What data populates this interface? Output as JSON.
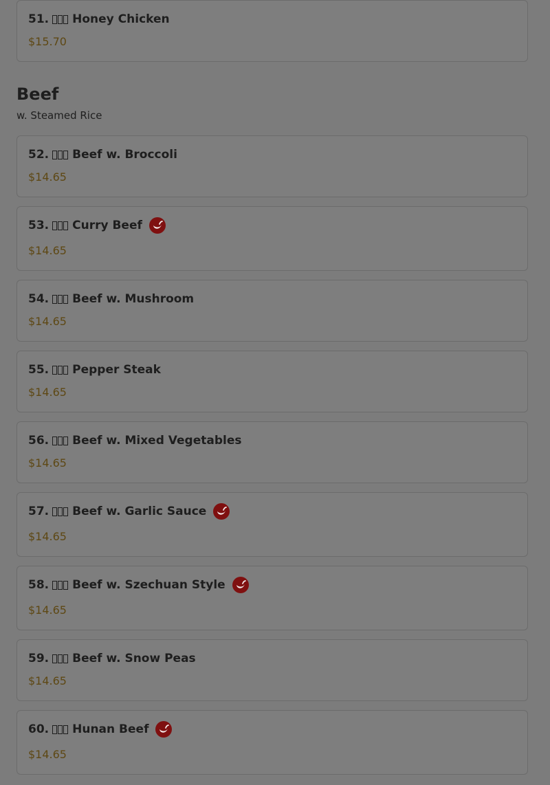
{
  "top_item": {
    "number": "51.",
    "name": "Honey Chicken",
    "price": "$15.70"
  },
  "section": {
    "title": "Beef",
    "subtitle": "w. Steamed Rice",
    "items": [
      {
        "number": "52.",
        "name": "Beef w. Broccoli",
        "price": "$14.65",
        "spicy": false
      },
      {
        "number": "53.",
        "name": "Curry Beef",
        "price": "$14.65",
        "spicy": true
      },
      {
        "number": "54.",
        "name": "Beef w. Mushroom",
        "price": "$14.65",
        "spicy": false
      },
      {
        "number": "55.",
        "name": "Pepper Steak",
        "price": "$14.65",
        "spicy": false
      },
      {
        "number": "56.",
        "name": "Beef w. Mixed Vegetables",
        "price": "$14.65",
        "spicy": false
      },
      {
        "number": "57.",
        "name": "Beef w. Garlic Sauce",
        "price": "$14.65",
        "spicy": true
      },
      {
        "number": "58.",
        "name": "Beef w. Szechuan Style",
        "price": "$14.65",
        "spicy": true
      },
      {
        "number": "59.",
        "name": "Beef w. Snow Peas",
        "price": "$14.65",
        "spicy": false
      },
      {
        "number": "60.",
        "name": "Hunan Beef",
        "price": "$14.65",
        "spicy": true
      }
    ]
  },
  "icons": {
    "spicy": "chili-pepper-icon"
  },
  "colors": {
    "price": "#5e4814",
    "spicy_badge": "#7f1010",
    "background": "#7c7c7c"
  }
}
